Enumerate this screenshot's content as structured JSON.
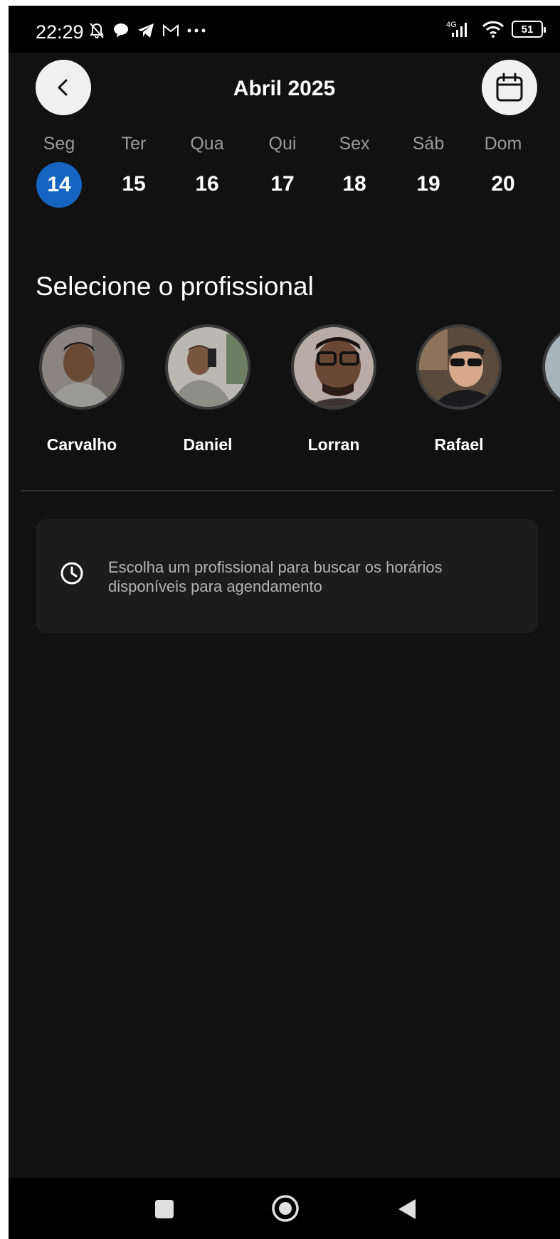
{
  "status_bar": {
    "time": "22:29",
    "left_icons": [
      "muted-bell-icon",
      "chat-bubble-icon",
      "telegram-icon",
      "gmail-icon",
      "more-dots-icon"
    ],
    "network": "4G",
    "battery": "51"
  },
  "header": {
    "back_icon": "chevron-left-icon",
    "title": "Abril 2025",
    "calendar_icon": "calendar-icon"
  },
  "week": {
    "days": [
      {
        "label": "Seg",
        "number": "14",
        "selected": true
      },
      {
        "label": "Ter",
        "number": "15",
        "selected": false
      },
      {
        "label": "Qua",
        "number": "16",
        "selected": false
      },
      {
        "label": "Qui",
        "number": "17",
        "selected": false
      },
      {
        "label": "Sex",
        "number": "18",
        "selected": false
      },
      {
        "label": "Sáb",
        "number": "19",
        "selected": false
      },
      {
        "label": "Dom",
        "number": "20",
        "selected": false
      }
    ],
    "selected_color": "#1565c0"
  },
  "professionals": {
    "title": "Selecione o profissional",
    "items": [
      {
        "name": "Carvalho"
      },
      {
        "name": "Daniel"
      },
      {
        "name": "Lorran"
      },
      {
        "name": "Rafael"
      }
    ]
  },
  "info_card": {
    "icon": "clock-icon",
    "message": "Escolha um profissional para buscar os horários disponíveis para agendamento"
  },
  "nav_bar": {
    "icons": [
      "recent-apps-icon",
      "home-icon",
      "back-triangle-icon"
    ]
  }
}
